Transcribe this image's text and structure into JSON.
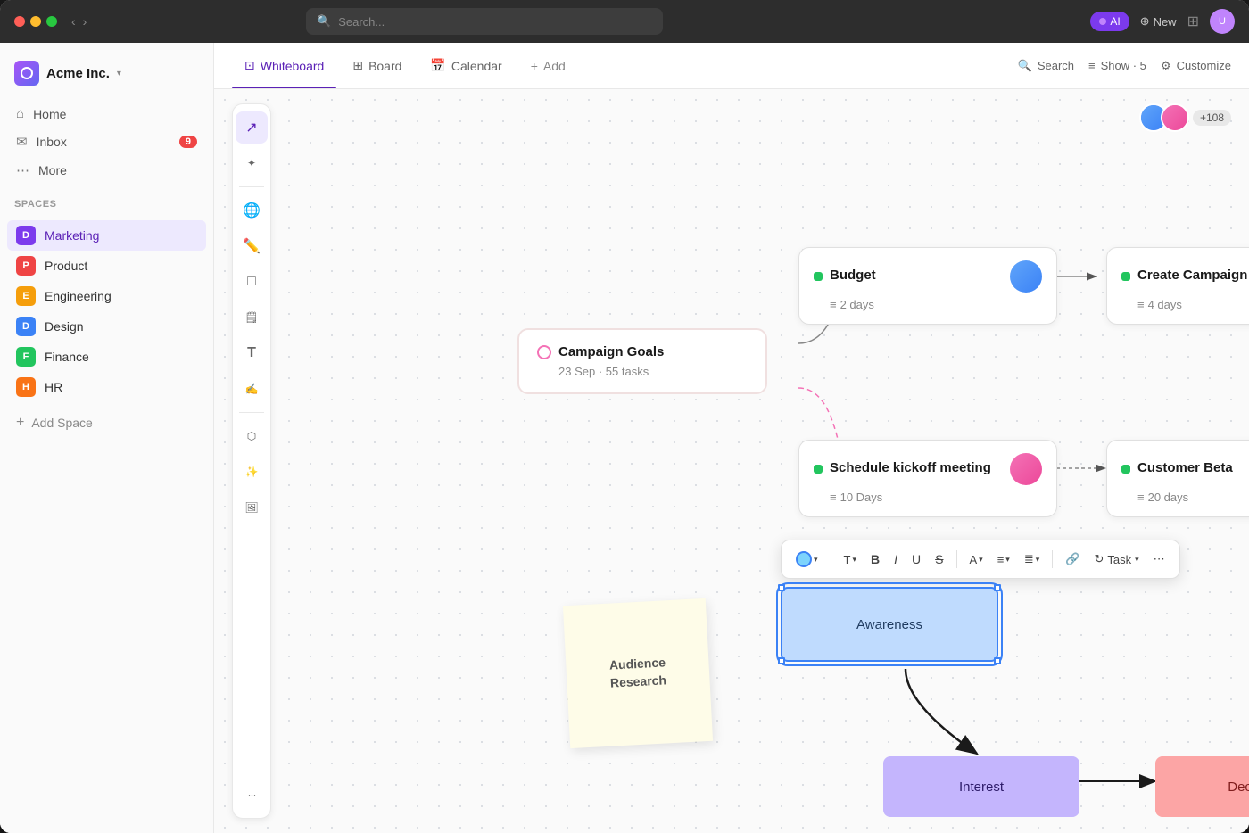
{
  "titleBar": {
    "searchPlaceholder": "Search...",
    "aiBadge": "AI",
    "newButton": "New"
  },
  "sidebar": {
    "company": "Acme Inc.",
    "nav": [
      {
        "id": "home",
        "label": "Home",
        "icon": "⌂",
        "badge": null
      },
      {
        "id": "inbox",
        "label": "Inbox",
        "icon": "✉",
        "badge": "9"
      },
      {
        "id": "more",
        "label": "More",
        "icon": "···",
        "badge": null
      }
    ],
    "spacesLabel": "Spaces",
    "spaces": [
      {
        "id": "marketing",
        "label": "Marketing",
        "color": "#7c3aed",
        "letter": "D",
        "active": true
      },
      {
        "id": "product",
        "label": "Product",
        "color": "#ef4444",
        "letter": "P",
        "active": false
      },
      {
        "id": "engineering",
        "label": "Engineering",
        "color": "#f59e0b",
        "letter": "E",
        "active": false
      },
      {
        "id": "design",
        "label": "Design",
        "color": "#3b82f6",
        "letter": "D",
        "active": false
      },
      {
        "id": "finance",
        "label": "Finance",
        "color": "#22c55e",
        "letter": "F",
        "active": false
      },
      {
        "id": "hr",
        "label": "HR",
        "color": "#f97316",
        "letter": "H",
        "active": false
      }
    ],
    "addSpaceLabel": "Add Space"
  },
  "tabs": [
    {
      "id": "whiteboard",
      "label": "Whiteboard",
      "icon": "⊡",
      "active": true
    },
    {
      "id": "board",
      "label": "Board",
      "icon": "⊞",
      "active": false
    },
    {
      "id": "calendar",
      "label": "Calendar",
      "icon": "📅",
      "active": false
    },
    {
      "id": "add",
      "label": "Add",
      "icon": "+",
      "active": false
    }
  ],
  "topNavRight": {
    "search": "Search",
    "show": "Show · 5",
    "customize": "Customize"
  },
  "toolbar": {
    "tools": [
      {
        "id": "select",
        "icon": "↗",
        "active": true
      },
      {
        "id": "magic",
        "icon": "✦",
        "active": false
      },
      {
        "id": "globe",
        "icon": "⊕",
        "active": false
      },
      {
        "id": "pen",
        "icon": "✏",
        "active": false
      },
      {
        "id": "shapes",
        "icon": "□",
        "active": false
      },
      {
        "id": "note",
        "icon": "🗒",
        "active": false
      },
      {
        "id": "text",
        "icon": "T",
        "active": false
      },
      {
        "id": "draw",
        "icon": "✍",
        "active": false
      },
      {
        "id": "network",
        "icon": "⬡",
        "active": false
      },
      {
        "id": "magic2",
        "icon": "✦",
        "active": false
      },
      {
        "id": "image",
        "icon": "🖼",
        "active": false
      },
      {
        "id": "more",
        "icon": "···",
        "active": false
      }
    ]
  },
  "avatarsCount": "+108",
  "cards": {
    "budget": {
      "title": "Budget",
      "meta": "2 days"
    },
    "createCampaign": {
      "title": "Create Campaign",
      "meta": "4 days"
    },
    "campaignGoals": {
      "title": "Campaign Goals",
      "date": "23 Sep",
      "tasks": "55 tasks"
    },
    "scheduleKickoff": {
      "title": "Schedule kickoff meeting",
      "meta": "10 Days"
    },
    "customerBeta": {
      "title": "Customer Beta",
      "meta": "20 days"
    }
  },
  "stickyNote": {
    "text": "Audience Research"
  },
  "flowBoxes": {
    "awareness": "Awareness",
    "interest": "Interest",
    "decision": "Decision"
  },
  "textToolbar": {
    "task": "Task",
    "more": "···"
  }
}
